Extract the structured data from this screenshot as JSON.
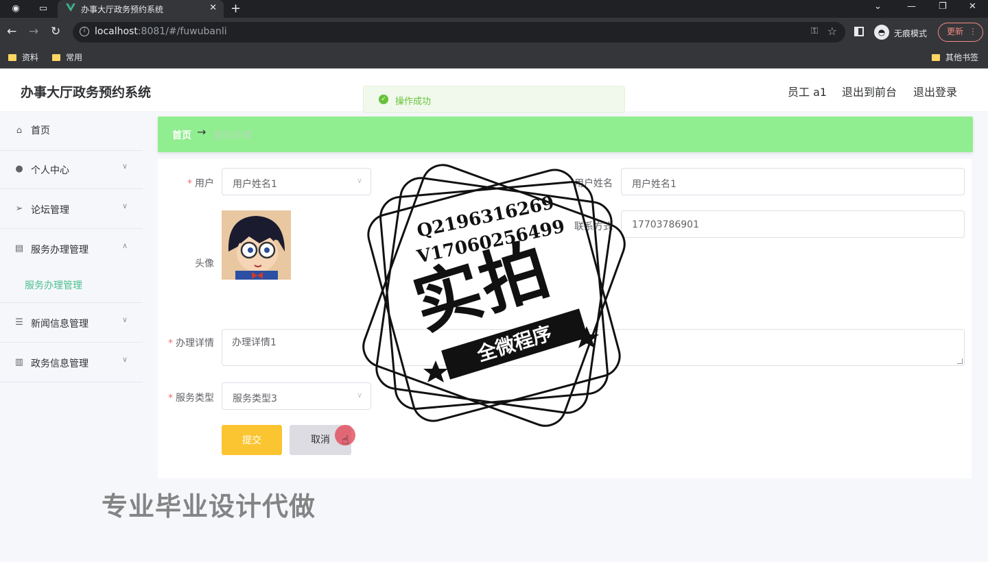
{
  "browser": {
    "tab_title": "办事大厅政务预约系统",
    "url_host": "localhost",
    "url_rest": ":8081/#/fuwubanli",
    "incognito_label": "无痕模式",
    "update_label": "更新",
    "bookmarks": [
      "资料",
      "常用"
    ],
    "other_bookmarks": "其他书签"
  },
  "header": {
    "site_title": "办事大厅政务预约系统",
    "user_label": "员工 a1",
    "back_front": "退出到前台",
    "logout": "退出登录"
  },
  "toast": {
    "message": "操作成功",
    "color": "#67c23a"
  },
  "sidebar": {
    "items": [
      {
        "label": "首页"
      },
      {
        "label": "个人中心"
      },
      {
        "label": "论坛管理"
      },
      {
        "label": "服务办理管理",
        "sub": "服务办理管理"
      },
      {
        "label": "新闻信息管理"
      },
      {
        "label": "政务信息管理"
      }
    ],
    "accent": "#4cc08f"
  },
  "breadcrumb": {
    "home": "首页",
    "arrow": "→",
    "current": "服务办理",
    "bg": "#90ee90"
  },
  "form": {
    "user_label": "用户",
    "user_value": "用户姓名1",
    "username_label": "用户姓名",
    "username_value": "用户姓名1",
    "contact_label": "联系方式",
    "contact_value": "17703786901",
    "avatar_label": "头像",
    "detail_label": "办理详情",
    "detail_value": "办理详情1",
    "service_label": "服务类型",
    "service_value": "服务类型3",
    "submit": "提交",
    "cancel": "取消"
  },
  "overlay": {
    "line1": "Q2196316269",
    "line2": "V17060256499",
    "big": "实拍",
    "ribbon": "全微程序",
    "watermark": "专业毕业设计代做"
  }
}
